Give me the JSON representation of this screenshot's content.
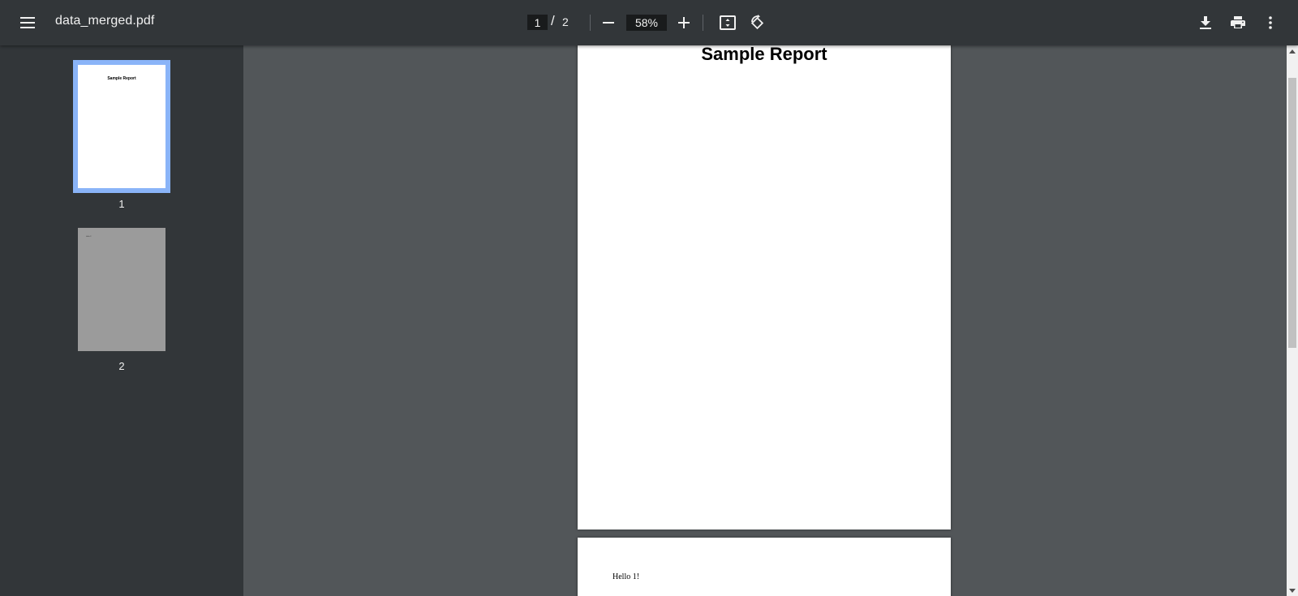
{
  "toolbar": {
    "file_name": "data_merged.pdf",
    "current_page": "1",
    "page_separator": "/",
    "total_pages": "2",
    "zoom": "58%"
  },
  "sidebar": {
    "thumbnails": [
      {
        "number": "1",
        "title": "Sample Report",
        "selected": true
      },
      {
        "number": "2",
        "text": "Hello 1!",
        "selected": false
      }
    ]
  },
  "document": {
    "pages": [
      {
        "title": "Sample Report"
      },
      {
        "text": "Hello 1!"
      }
    ]
  },
  "icons": {
    "menu": "hamburger-menu-icon",
    "zoom_out": "minus-icon",
    "zoom_in": "plus-icon",
    "fit": "fit-to-page-icon",
    "rotate": "rotate-counterclockwise-icon",
    "download": "download-icon",
    "print": "print-icon",
    "more": "more-vertical-icon"
  },
  "colors": {
    "toolbar_bg": "#323639",
    "viewer_bg": "#525659",
    "thumbnail_selected_border": "#8ab4f8"
  }
}
